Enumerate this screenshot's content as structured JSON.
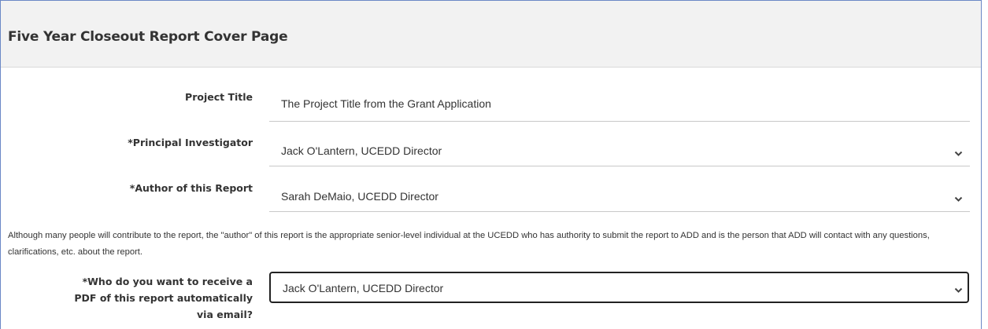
{
  "page": {
    "title": "Five Year Closeout Report Cover Page"
  },
  "fields": {
    "project_title": {
      "label": "Project Title",
      "value": "The Project Title from the Grant Application"
    },
    "principal_investigator": {
      "label": "*Principal Investigator",
      "value": "Jack O'Lantern, UCEDD Director",
      "icon": "chevron-down-icon"
    },
    "author": {
      "label": "*Author of this Report",
      "value": "Sarah DeMaio, UCEDD Director",
      "icon": "chevron-down-icon"
    },
    "author_note": "Although many people will contribute to the report, the \"author\" of this report is the appropriate senior-level individual at the UCEDD who has authority to submit the report to ADD and is the person that ADD will contact with any questions, clarifications, etc. about the report.",
    "pdf_recipient": {
      "label_line1": "*Who do you want to receive a",
      "label_line2": "PDF of this report automatically",
      "label_line3": "via email?",
      "value": "Jack O'Lantern, UCEDD Director",
      "icon": "chevron-down-icon"
    }
  },
  "colors": {
    "panel_border": "#6b88c6",
    "header_bg": "#f2f2f2",
    "text": "#333333",
    "focused_border": "#222222"
  }
}
